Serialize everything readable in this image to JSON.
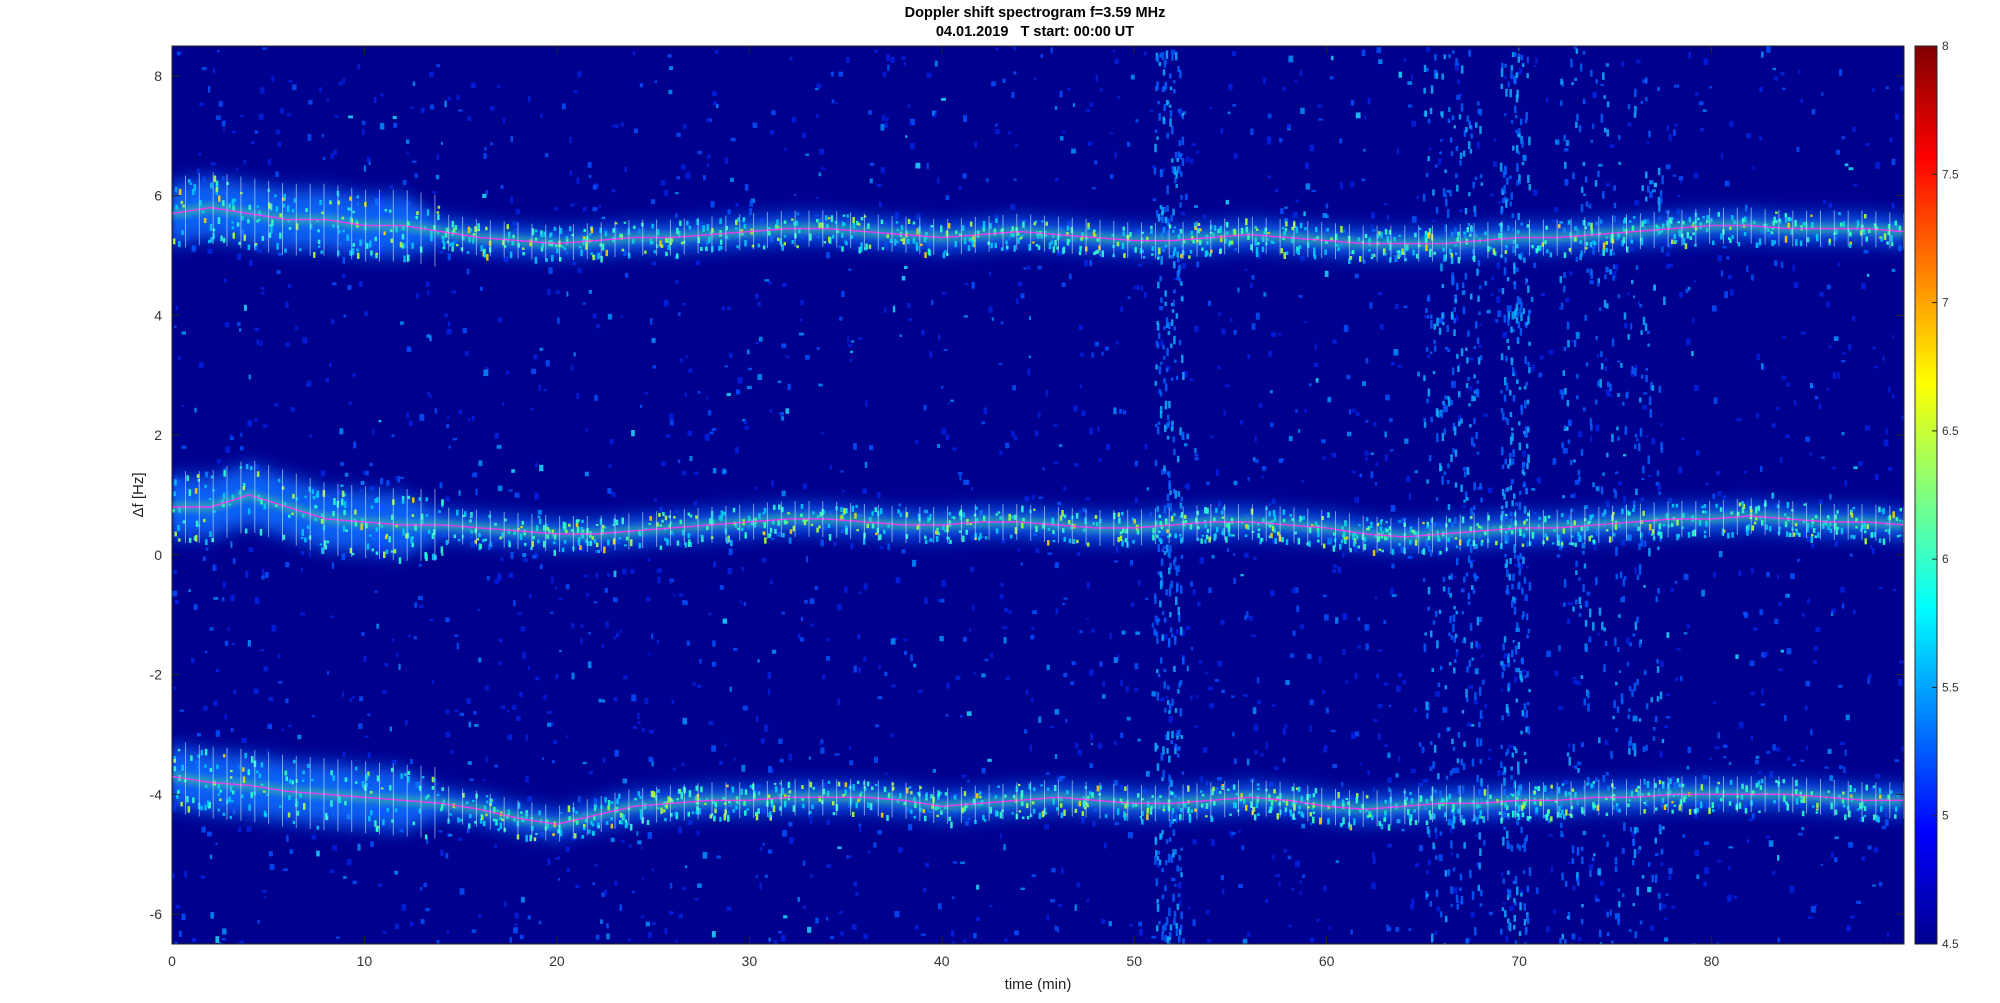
{
  "chart_data": {
    "type": "heatmap",
    "title": "Doppler shift spectrogram f=3.59 MHz",
    "subtitle": "04.01.2019   T start: 00:00 UT",
    "xlabel": "time (min)",
    "ylabel": "Δf [Hz]",
    "xlim": [
      0,
      90
    ],
    "ylim": [
      -6.5,
      8.5
    ],
    "xticks": [
      0,
      10,
      20,
      30,
      40,
      50,
      60,
      70,
      80
    ],
    "yticks": [
      8,
      6,
      4,
      2,
      0,
      -2,
      -4,
      -6
    ],
    "colorbar": {
      "range": [
        4.5,
        8
      ],
      "ticks": [
        8,
        7.5,
        7,
        6.5,
        6,
        5.5,
        5,
        4.5
      ],
      "colormap": "jet"
    },
    "series": [
      {
        "t": [
          0,
          2,
          4,
          6,
          8,
          10,
          12,
          14,
          16,
          18,
          20,
          22,
          24,
          26,
          28,
          30,
          32,
          34,
          36,
          38,
          40,
          42,
          44,
          46,
          48,
          50,
          52,
          54,
          56,
          58,
          60,
          62,
          64,
          66,
          68,
          70,
          72,
          74,
          76,
          78,
          80,
          82,
          84,
          86,
          88,
          90
        ],
        "df": [
          5.7,
          5.8,
          5.7,
          5.6,
          5.6,
          5.5,
          5.5,
          5.4,
          5.3,
          5.25,
          5.2,
          5.25,
          5.3,
          5.3,
          5.35,
          5.4,
          5.45,
          5.45,
          5.4,
          5.35,
          5.3,
          5.35,
          5.4,
          5.35,
          5.3,
          5.25,
          5.25,
          5.3,
          5.35,
          5.3,
          5.25,
          5.2,
          5.2,
          5.2,
          5.25,
          5.3,
          5.3,
          5.35,
          5.4,
          5.45,
          5.5,
          5.5,
          5.45,
          5.45,
          5.45,
          5.4
        ]
      },
      {
        "t": [
          0,
          2,
          4,
          6,
          8,
          10,
          12,
          14,
          16,
          18,
          20,
          22,
          24,
          26,
          28,
          30,
          32,
          34,
          36,
          38,
          40,
          42,
          44,
          46,
          48,
          50,
          52,
          54,
          56,
          58,
          60,
          62,
          64,
          66,
          68,
          70,
          72,
          74,
          76,
          78,
          80,
          82,
          84,
          86,
          88,
          90
        ],
        "df": [
          0.8,
          0.8,
          1.0,
          0.8,
          0.6,
          0.55,
          0.5,
          0.5,
          0.45,
          0.4,
          0.35,
          0.35,
          0.4,
          0.45,
          0.5,
          0.55,
          0.6,
          0.6,
          0.55,
          0.5,
          0.5,
          0.55,
          0.55,
          0.5,
          0.45,
          0.45,
          0.5,
          0.55,
          0.55,
          0.5,
          0.45,
          0.35,
          0.3,
          0.35,
          0.4,
          0.45,
          0.45,
          0.5,
          0.55,
          0.6,
          0.6,
          0.65,
          0.6,
          0.55,
          0.55,
          0.5
        ]
      },
      {
        "t": [
          0,
          2,
          4,
          6,
          8,
          10,
          12,
          14,
          16,
          18,
          20,
          22,
          24,
          26,
          28,
          30,
          32,
          34,
          36,
          38,
          40,
          42,
          44,
          46,
          48,
          50,
          52,
          54,
          56,
          58,
          60,
          62,
          64,
          66,
          68,
          70,
          72,
          74,
          76,
          78,
          80,
          82,
          84,
          86,
          88,
          90
        ],
        "df": [
          -3.7,
          -3.8,
          -3.85,
          -3.95,
          -4.0,
          -4.05,
          -4.1,
          -4.15,
          -4.25,
          -4.4,
          -4.5,
          -4.35,
          -4.2,
          -4.15,
          -4.1,
          -4.1,
          -4.05,
          -4.05,
          -4.05,
          -4.1,
          -4.2,
          -4.15,
          -4.1,
          -4.05,
          -4.1,
          -4.15,
          -4.15,
          -4.1,
          -4.05,
          -4.1,
          -4.2,
          -4.25,
          -4.2,
          -4.15,
          -4.15,
          -4.1,
          -4.1,
          -4.05,
          -4.05,
          -4.0,
          -4.0,
          -4.0,
          -4.0,
          -4.05,
          -4.1,
          -4.1
        ]
      }
    ]
  }
}
